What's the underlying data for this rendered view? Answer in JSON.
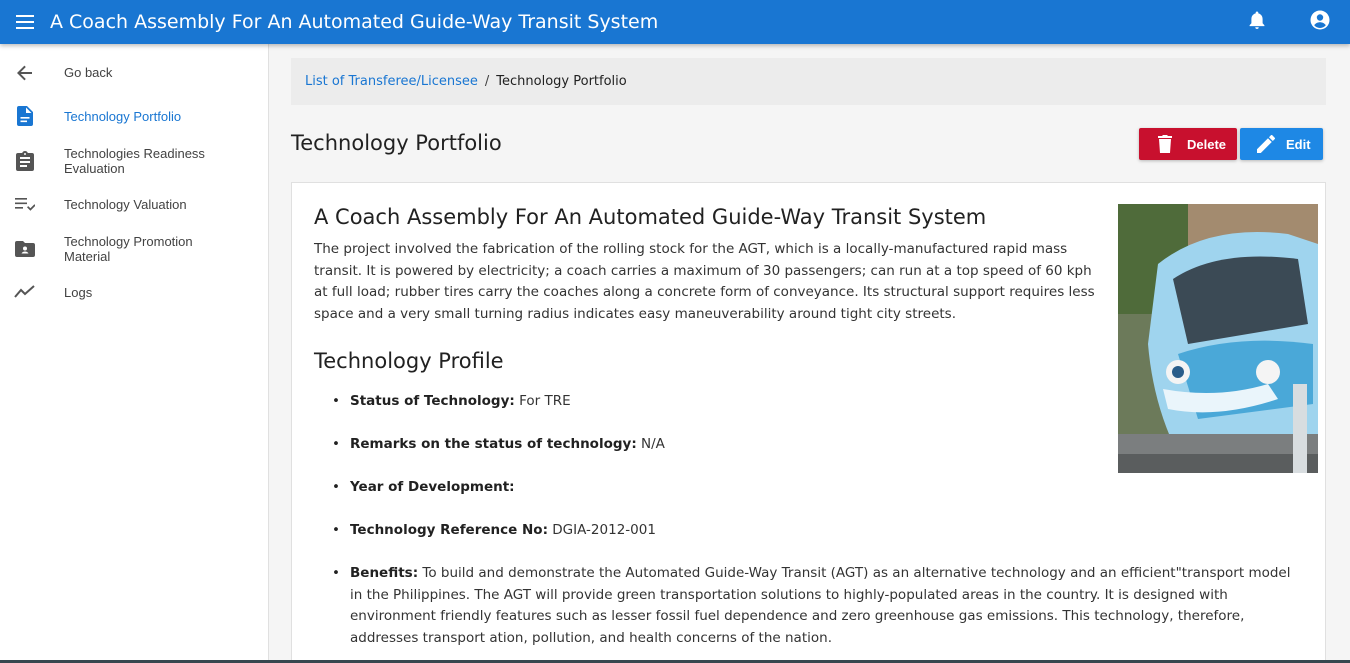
{
  "appbar": {
    "title": "A Coach Assembly For An Automated Guide-Way Transit System",
    "icons": [
      "menu-icon",
      "bell-icon",
      "account-icon"
    ]
  },
  "sidebar": {
    "items": [
      {
        "label": "Go back",
        "icon": "arrow-left-icon",
        "active": false
      },
      {
        "label": "Technology Portfolio",
        "icon": "document-icon",
        "active": true
      },
      {
        "label": "Technologies Readiness Evaluation",
        "icon": "clipboard-icon",
        "active": false
      },
      {
        "label": "Technology Valuation",
        "icon": "checklist-icon",
        "active": false
      },
      {
        "label": "Technology Promotion Material",
        "icon": "folder-account-icon",
        "active": false
      },
      {
        "label": "Logs",
        "icon": "trending-icon",
        "active": false
      }
    ]
  },
  "breadcrumb": {
    "link": "List of Transferee/Licensee",
    "separator": "/",
    "current": "Technology Portfolio"
  },
  "page": {
    "title": "Technology Portfolio",
    "delete_label": "Delete",
    "edit_label": "Edit"
  },
  "tech": {
    "title": "A Coach Assembly For An Automated Guide-Way Transit System",
    "description": "The project involved the fabrication of the rolling stock for the AGT, which is a locally-manufactured rapid mass transit. It is powered by electricity; a coach carries a maximum of 30 passengers; can run at a top speed of 60 kph at full load; rubber tires carry the coaches along a concrete form of conveyance. Its structural support requires less space and a very small turning radius indicates easy maneuverability around tight city streets.",
    "profile_heading": "Technology Profile",
    "profile": [
      {
        "key": "Status of Technology:",
        "value": "For TRE"
      },
      {
        "key": "Remarks on the status of technology:",
        "value": "N/A"
      },
      {
        "key": "Year of Development:",
        "value": ""
      },
      {
        "key": "Technology Reference No:",
        "value": "DGIA-2012-001"
      },
      {
        "key": "Benefits:",
        "value": "To build and demonstrate the Automated Guide-Way Transit (AGT) as an alternative technology and an efficient\"transport model in the Philippines. The AGT will provide green transportation solutions to highly-populated areas in the country. It is designed with environment friendly features such as lesser fossil fuel dependence and zero greenhouse gas emissions. This technology, therefore, addresses transport ation, pollution, and health concerns of the nation."
      }
    ]
  },
  "colors": {
    "primary": "#1976d2",
    "delete": "#c8102e",
    "edit": "#1e88e5"
  }
}
